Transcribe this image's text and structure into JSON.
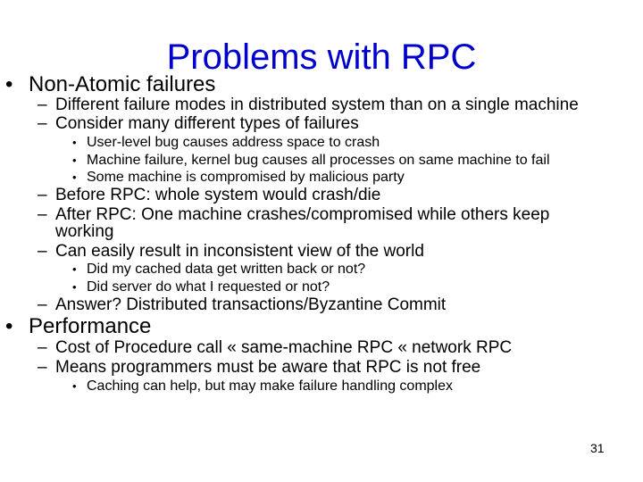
{
  "slide": {
    "title": "Problems with RPC",
    "page_number": "31",
    "bullets": {
      "non_atomic": "Non-Atomic failures",
      "na_1": "Different failure modes in distributed system than on a single machine",
      "na_2": "Consider many different types of failures",
      "na_2_a": "User-level bug causes address space to crash",
      "na_2_b": "Machine failure, kernel bug causes all processes on same machine to fail",
      "na_2_c": "Some machine is compromised by malicious party",
      "na_3": "Before RPC: whole system would crash/die",
      "na_4_line1": "After RPC: One machine crashes/compromised while others keep",
      "na_4_line2": "working",
      "na_5": "Can easily result in inconsistent view of the world",
      "na_5_a": "Did my cached data get written back or not?",
      "na_5_b": "Did server do what I requested or not?",
      "na_6": "Answer? Distributed transactions/Byzantine Commit",
      "performance": "Performance",
      "perf_1": "Cost of Procedure call « same-machine RPC « network RPC",
      "perf_2": "Means programmers must be aware that RPC is not free",
      "perf_2_a": "Caching can help, but may make failure handling complex"
    },
    "markers": {
      "level1": "•",
      "level2": "–",
      "level3": "•"
    }
  }
}
